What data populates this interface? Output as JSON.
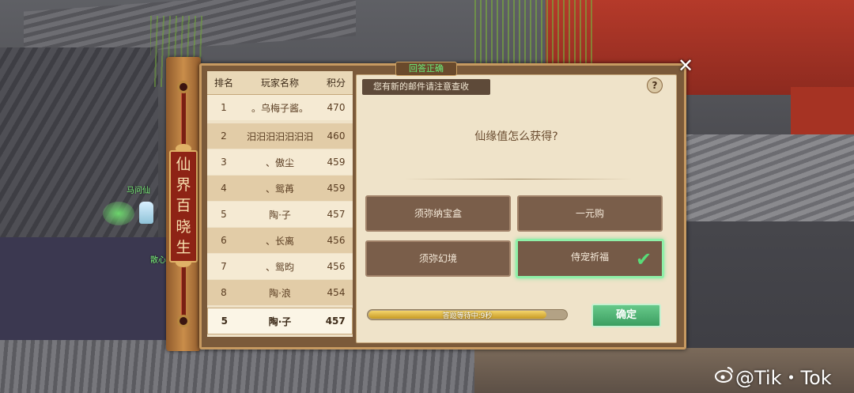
{
  "scene": {
    "npcs": [
      {
        "name": "马问仙"
      },
      {
        "name": "散心"
      }
    ]
  },
  "banner": {
    "chars": [
      "仙",
      "界",
      "百",
      "晓",
      "生"
    ]
  },
  "ranking": {
    "headers": {
      "rank": "排名",
      "name": "玩家名称",
      "score": "积分"
    },
    "rows": [
      {
        "rank": "1",
        "name": "。乌梅子酱。",
        "score": "470"
      },
      {
        "rank": "2",
        "name": "汨汨汨汨汨汨汨",
        "score": "460"
      },
      {
        "rank": "3",
        "name": "、傲尘",
        "score": "459"
      },
      {
        "rank": "4",
        "name": "、鸳苒",
        "score": "459"
      },
      {
        "rank": "5",
        "name": "陶·子",
        "score": "457"
      },
      {
        "rank": "6",
        "name": "、长离",
        "score": "456"
      },
      {
        "rank": "7",
        "name": "、鸳昀",
        "score": "456"
      },
      {
        "rank": "8",
        "name": "陶·浪",
        "score": "454"
      }
    ],
    "self": {
      "rank": "5",
      "name": "陶·子",
      "score": "457"
    }
  },
  "quiz": {
    "result_tag": "回答正确",
    "mail_notice": "您有新的邮件请注意查收",
    "help_label": "?",
    "question": "仙缘值怎么获得?",
    "options": [
      {
        "label": "须弥纳宝盒",
        "selected": false
      },
      {
        "label": "一元购",
        "selected": false
      },
      {
        "label": "须弥幻境",
        "selected": false
      },
      {
        "label": "侍宠祈福",
        "selected": true
      }
    ],
    "check_mark": "✔",
    "timer": {
      "text": "答题等待中:9秒",
      "progress": 0.9
    },
    "confirm_label": "确定",
    "close_label": "✕"
  },
  "watermark": {
    "text": "@Tik・Tok"
  },
  "colors": {
    "selected_border": "#8ff0a8",
    "confirm_green": "#3c9e61",
    "correct_text": "#6bf07a",
    "banner_red": "#8e2315"
  }
}
